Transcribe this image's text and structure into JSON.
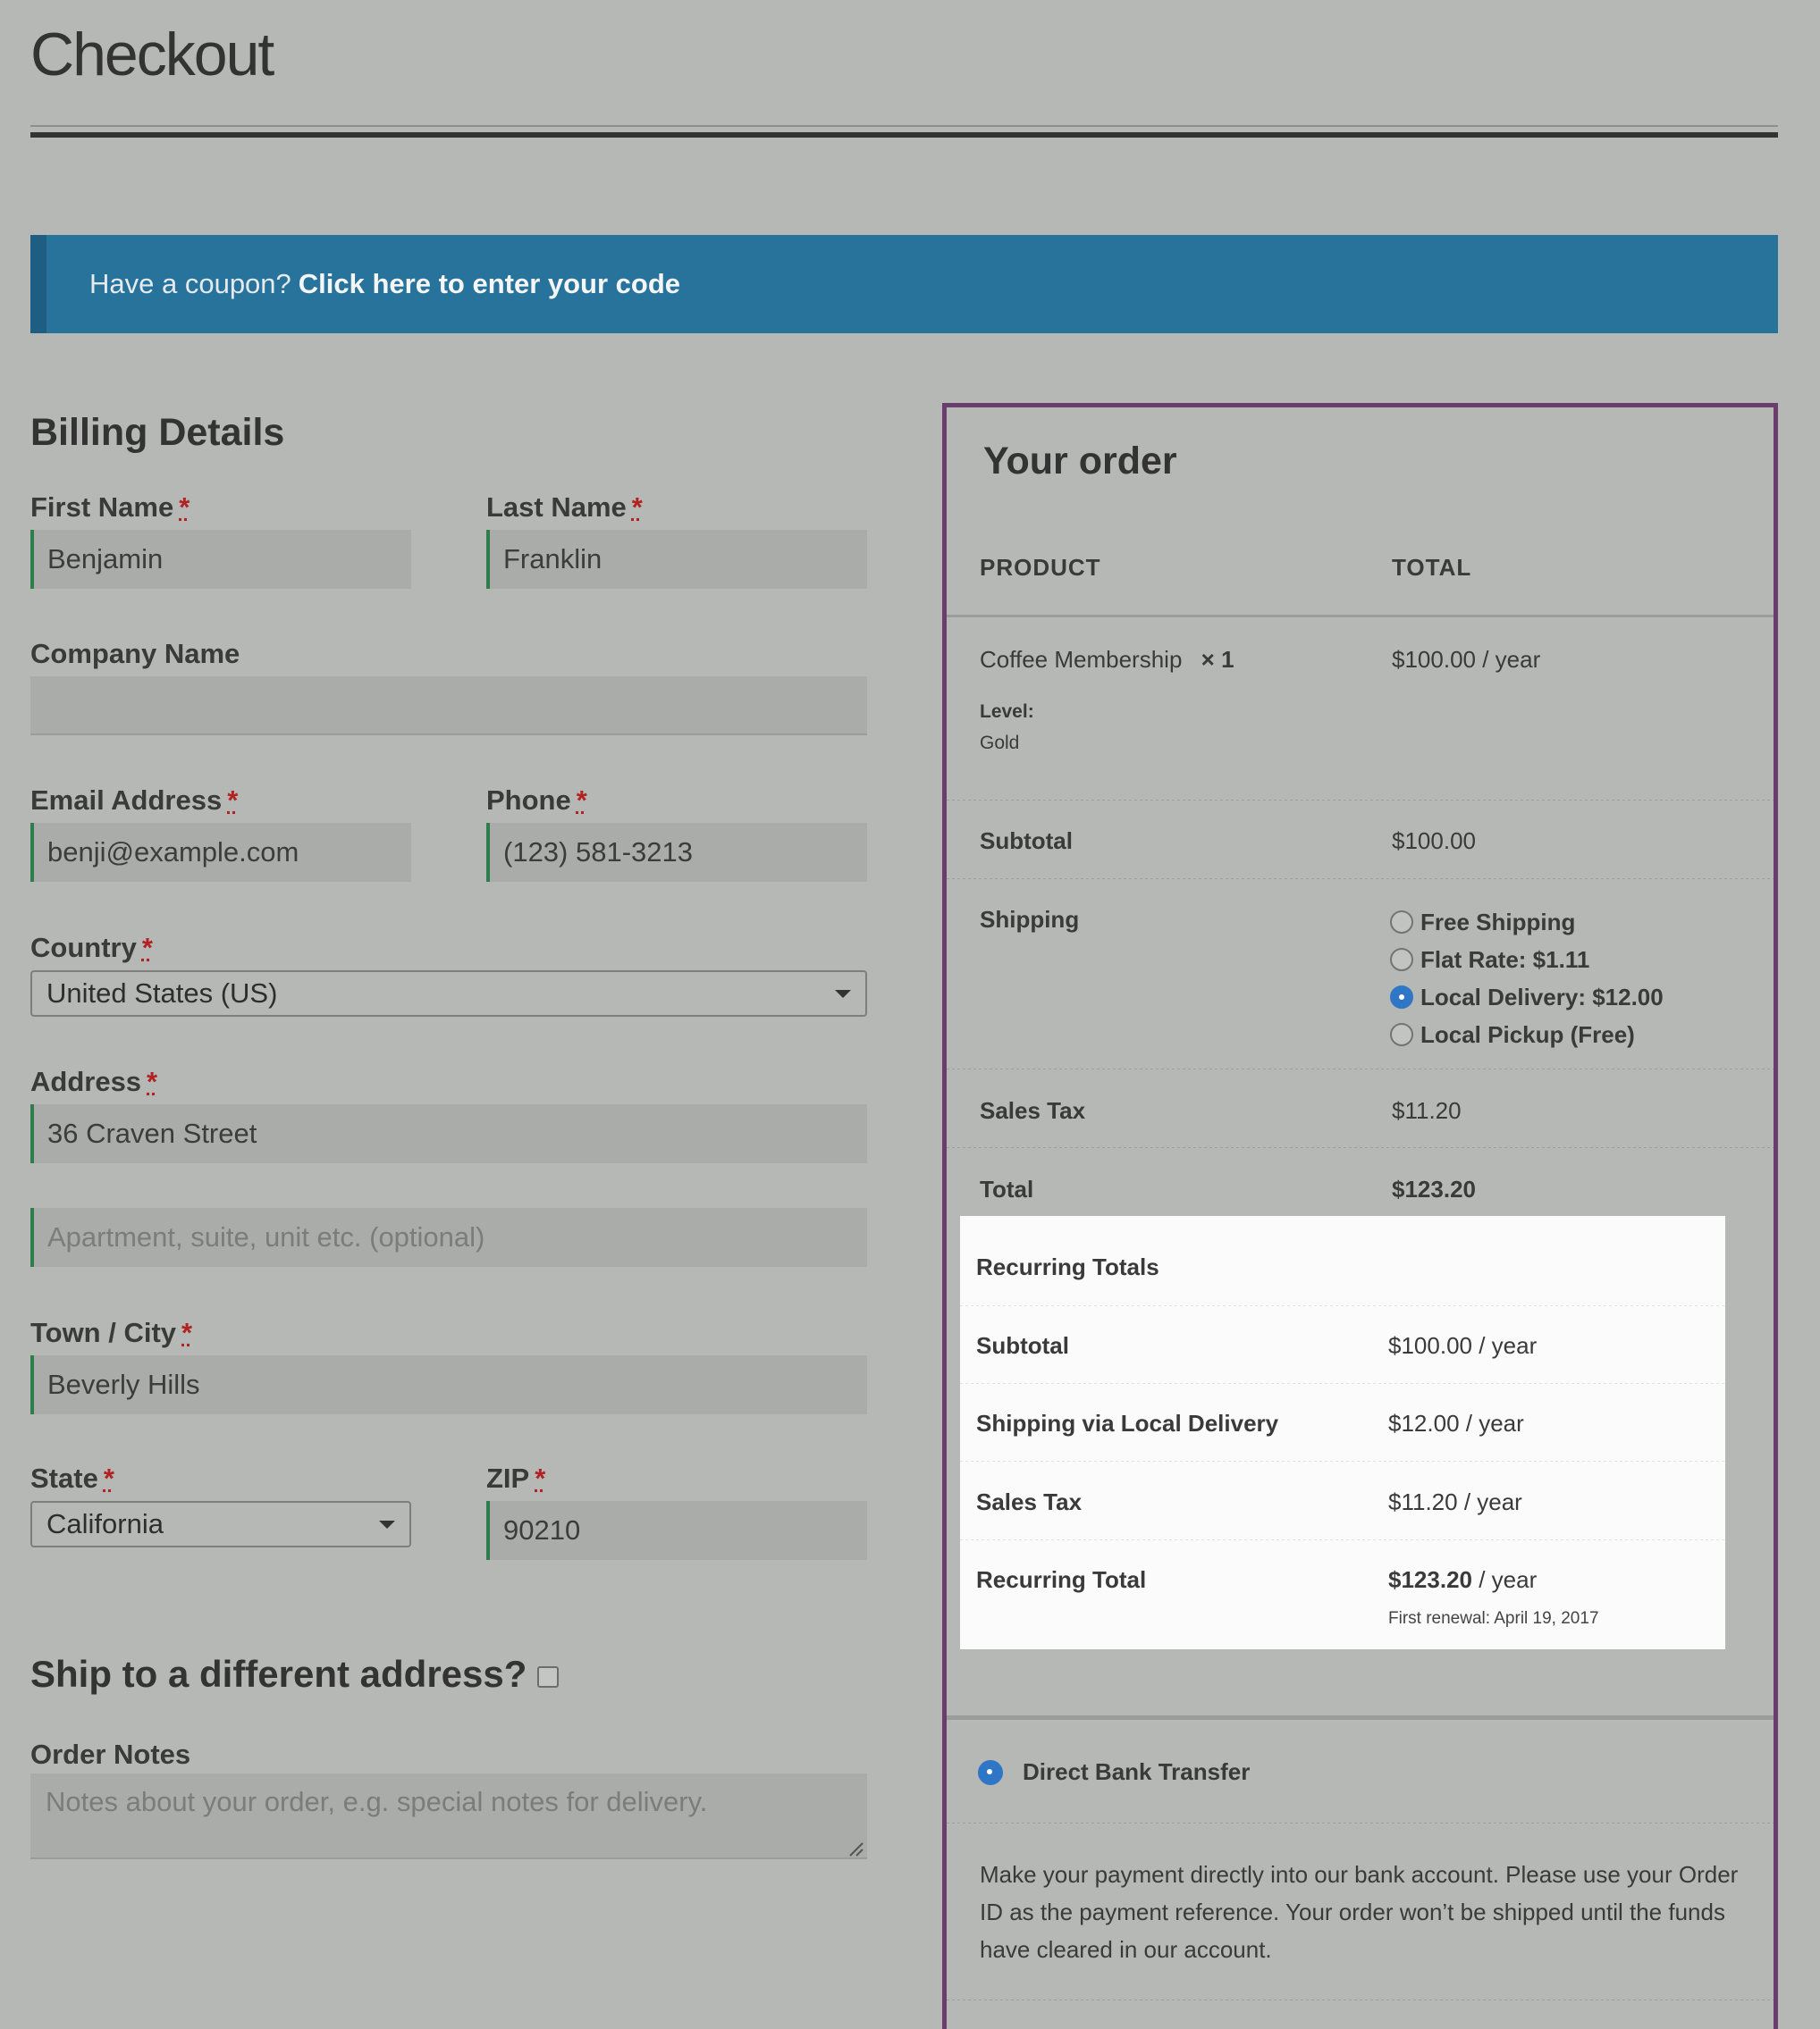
{
  "page": {
    "title": "Checkout"
  },
  "coupon": {
    "prompt": "Have a coupon?",
    "link": "Click here to enter your code"
  },
  "billing": {
    "title": "Billing Details",
    "required_mark": "*",
    "first_name": {
      "label": "First Name",
      "value": "Benjamin"
    },
    "last_name": {
      "label": "Last Name",
      "value": "Franklin"
    },
    "company": {
      "label": "Company Name",
      "value": ""
    },
    "email": {
      "label": "Email Address",
      "value": "benji@example.com"
    },
    "phone": {
      "label": "Phone",
      "value": "(123) 581-3213"
    },
    "country": {
      "label": "Country",
      "value": "United States (US)"
    },
    "address": {
      "label": "Address",
      "value": "36 Craven Street",
      "line2_placeholder": "Apartment, suite, unit etc. (optional)"
    },
    "city": {
      "label": "Town / City",
      "value": "Beverly Hills"
    },
    "state": {
      "label": "State",
      "value": "California"
    },
    "zip": {
      "label": "ZIP",
      "value": "90210"
    }
  },
  "shipping_toggle": {
    "label": "Ship to a different address?",
    "checked": false
  },
  "notes": {
    "label": "Order Notes",
    "placeholder": "Notes about your order, e.g. special notes for delivery."
  },
  "order": {
    "title": "Your order",
    "col_product": "PRODUCT",
    "col_total": "TOTAL",
    "item": {
      "name": "Coffee Membership",
      "qty": "× 1",
      "total": "$100.00 / year",
      "meta_label": "Level:",
      "meta_value": "Gold"
    },
    "subtotal": {
      "label": "Subtotal",
      "value": "$100.00"
    },
    "shipping": {
      "label": "Shipping",
      "options": [
        {
          "label": "Free Shipping",
          "selected": false
        },
        {
          "label": "Flat Rate: $1.11",
          "selected": false
        },
        {
          "label": "Local Delivery: $12.00",
          "selected": true
        },
        {
          "label": "Local Pickup (Free)",
          "selected": false
        }
      ]
    },
    "sales_tax": {
      "label": "Sales Tax",
      "value": "$11.20"
    },
    "total": {
      "label": "Total",
      "value": "$123.20"
    },
    "recurring": {
      "title": "Recurring Totals",
      "subtotal": {
        "label": "Subtotal",
        "value": "$100.00 / year"
      },
      "shipping": {
        "label": "Shipping via Local Delivery",
        "value": "$12.00 / year"
      },
      "sales_tax": {
        "label": "Sales Tax",
        "value": "$11.20 / year"
      },
      "total": {
        "label": "Recurring Total",
        "amount": "$123.20",
        "period": " / year",
        "renewal": "First renewal: April 19, 2017"
      }
    }
  },
  "payment": {
    "method": "Direct Bank Transfer",
    "description": "Make your payment directly into our bank account. Please use your Order ID as the payment reference. Your order won’t be shipped until the funds have cleared in our account."
  },
  "colors": {
    "coupon_bar": "#27739b",
    "panel_border": "#6b3d6e",
    "radio_selected": "#2f76c6",
    "valid_field": "#2e7d4a"
  }
}
